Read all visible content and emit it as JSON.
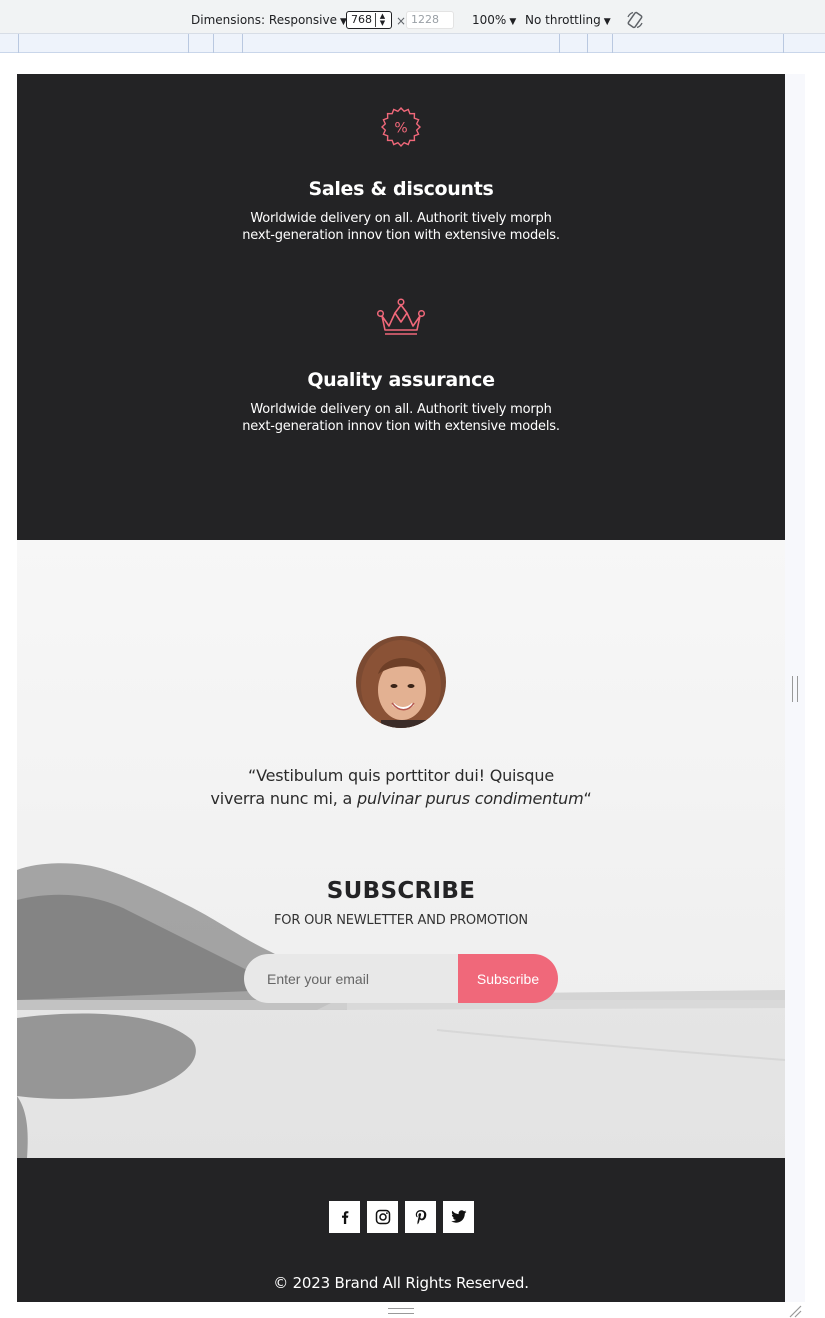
{
  "devtools": {
    "dimensions_label": "Dimensions: Responsive",
    "width_value": "768",
    "height_placeholder": "1228",
    "times_sign": "×",
    "zoom": "100%",
    "throttling": "No throttling"
  },
  "features": [
    {
      "icon": "percent-badge-icon",
      "title": "Sales & discounts",
      "text_line1": "Worldwide delivery on all. Authorit tively morph",
      "text_line2": "next-generation innov tion with extensive models."
    },
    {
      "icon": "crown-icon",
      "title": "Quality assurance",
      "text_line1": "Worldwide delivery on all. Authorit tively morph",
      "text_line2": "next-generation innov tion with extensive models."
    }
  ],
  "testimonial": {
    "line1": "“Vestibulum quis porttitor dui! Quisque",
    "line2_prefix": "viverra nunc mi, a ",
    "line2_italic": "pulvinar purus condimentum",
    "line2_suffix": "“"
  },
  "subscribe": {
    "title": "SUBSCRIBE",
    "subtitle": "FOR OUR NEWLETTER AND PROMOTION",
    "email_placeholder": "Enter your email",
    "button_label": "Subscribe"
  },
  "footer": {
    "socials": [
      "facebook-icon",
      "instagram-icon",
      "pinterest-icon",
      "twitter-icon"
    ],
    "copyright": "© 2023 Brand All Rights Reserved."
  },
  "colors": {
    "dark": "#232325",
    "accent": "#f0687a"
  }
}
